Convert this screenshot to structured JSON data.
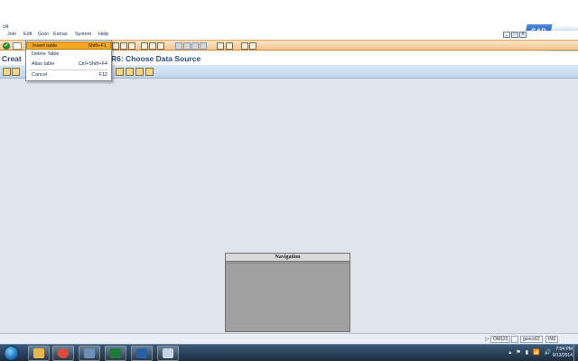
{
  "titlebar": {
    "glyph": "ᴜʀ"
  },
  "menu": {
    "items": [
      "Join",
      "Edit",
      "Goto",
      "Extras",
      "System",
      "Help"
    ]
  },
  "window_controls": [
    "_",
    "□",
    "✕"
  ],
  "brand": {
    "logo": "SAP"
  },
  "toolbar": {
    "check": "✔"
  },
  "dropdown": {
    "items": [
      {
        "label": "Insert table",
        "shortcut": "Shift+F1"
      },
      {
        "label": "Delete Table",
        "shortcut": ""
      },
      {
        "label": "Alias table",
        "shortcut": "Ctrl+Shift+F4"
      },
      {
        "label": "Cancel",
        "shortcut": "F12"
      }
    ]
  },
  "app": {
    "title_left": "Creat",
    "title_right": "R6: Choose Data Source"
  },
  "navigation": {
    "title": "Navigation"
  },
  "status": {
    "arrow": "▷",
    "system": "OM123",
    "client": "gcecc62",
    "mode": "INS"
  },
  "taskbar": {
    "apps": [
      "explorer",
      "chrome",
      "files",
      "excel",
      "outlook",
      "sap"
    ],
    "colors": {
      "explorer": "#e8b84a",
      "chrome": "#dd4b39",
      "files": "#6a8fb8",
      "excel": "#1f7a3a",
      "outlook": "#2a5fa8",
      "sap": "#c6d4e6"
    }
  },
  "tray": {
    "items": [
      "▴",
      "⚑",
      "▮",
      "📶",
      "🔊"
    ]
  },
  "clock": {
    "time": "7:54 PM",
    "date": "9/13/2014"
  }
}
